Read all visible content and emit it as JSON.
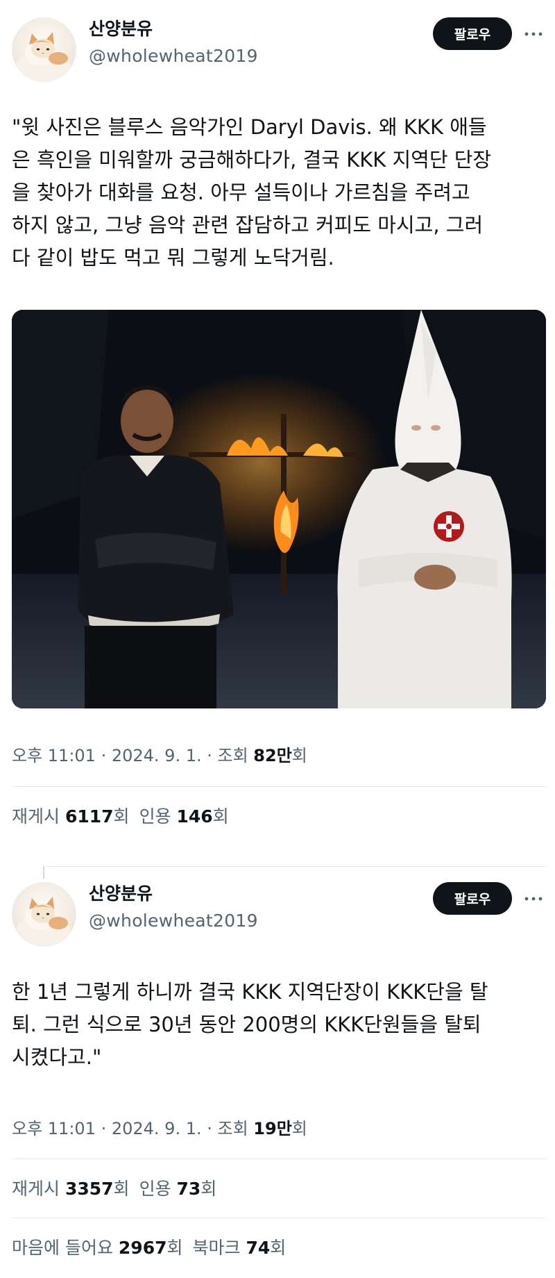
{
  "tweets": [
    {
      "author": {
        "name": "산양분유",
        "handle": "@wholewheat2019",
        "avatar_icon": "cat-avatar-icon"
      },
      "follow_label": "팔로우",
      "more_icon": "more-dots-icon",
      "text_lines": [
        "\"윗 사진은 블루스 음악가인 Daryl Davis.  왜 KKK 애들",
        "은 흑인을 미워할까 궁금해하다가, 결국 KKK 지역단 단장",
        "을 찾아가 대화를 요청.  아무 설득이나 가르침을 주려고",
        "하지 않고, 그냥 음악 관련 잡담하고 커피도 마시고, 그러",
        "다 같이 밥도 먹고 뭐 그렇게 노닥거림."
      ],
      "has_photo": true,
      "meta": {
        "time": "오후 11:01",
        "sep1": " · ",
        "date": "2024. 9. 1.",
        "sep2": " · ",
        "views_label": "조회 ",
        "views_value": "82만",
        "views_suffix": "회"
      },
      "stats": {
        "reposts_label": "재게시 ",
        "reposts_value": "6117",
        "reposts_suffix": "회",
        "quotes_label": "인용 ",
        "quotes_value": "146",
        "quotes_suffix": "회"
      }
    },
    {
      "author": {
        "name": "산양분유",
        "handle": "@wholewheat2019",
        "avatar_icon": "cat-avatar-icon"
      },
      "follow_label": "팔로우",
      "more_icon": "more-dots-icon",
      "text_lines": [
        "한 1년 그렇게 하니까 결국 KKK 지역단장이 KKK단을 탈",
        "퇴.  그런 식으로 30년 동안 200명의 KKK단원들을 탈퇴",
        "시켰다고.\""
      ],
      "has_photo": false,
      "meta": {
        "time": "오후 11:01",
        "sep1": " · ",
        "date": "2024. 9. 1.",
        "sep2": " · ",
        "views_label": "조회 ",
        "views_value": "19만",
        "views_suffix": "회"
      },
      "stats": {
        "reposts_label": "재게시 ",
        "reposts_value": "3357",
        "reposts_suffix": "회",
        "quotes_label": "인용 ",
        "quotes_value": "73",
        "quotes_suffix": "회",
        "likes_label": "마음에 들어요 ",
        "likes_value": "2967",
        "likes_suffix": "회",
        "bookmarks_label": "북마크 ",
        "bookmarks_value": "74",
        "bookmarks_suffix": "회"
      }
    }
  ],
  "colors": {
    "text_primary": "#0f1419",
    "text_secondary": "#536471",
    "follow_button": "#0f1419",
    "divider": "#e6e9eb"
  }
}
